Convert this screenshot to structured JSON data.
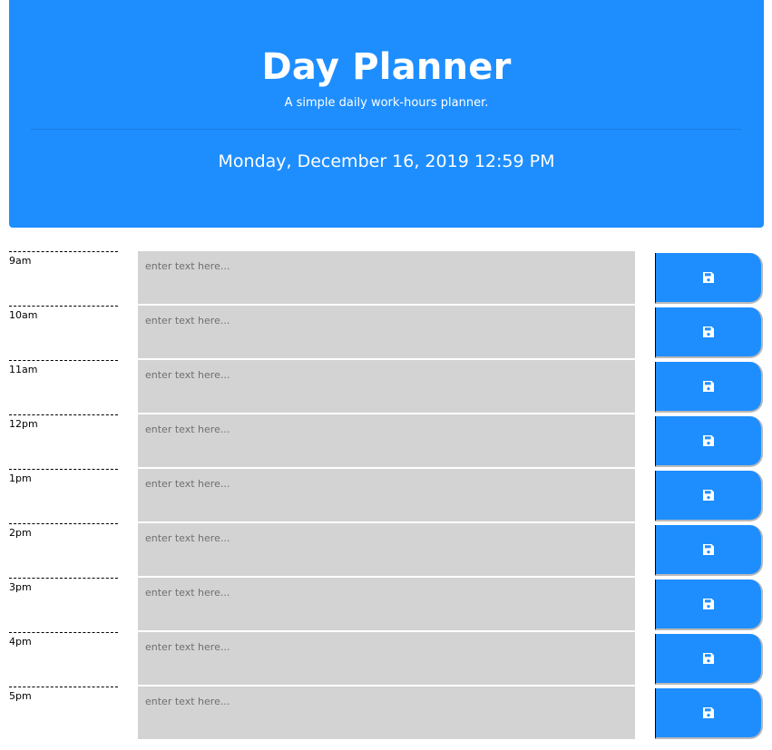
{
  "header": {
    "title": "Day Planner",
    "subtitle": "A simple daily work-hours planner.",
    "current_date": "Monday, December 16, 2019 12:59 PM"
  },
  "colors": {
    "primary": "#1e8eff",
    "textarea_bg": "#d3d3d3"
  },
  "planner": {
    "placeholder": "enter text here...",
    "save_icon": "floppy-disk-icon",
    "hours": [
      {
        "label": "9am",
        "text": ""
      },
      {
        "label": "10am",
        "text": ""
      },
      {
        "label": "11am",
        "text": ""
      },
      {
        "label": "12pm",
        "text": ""
      },
      {
        "label": "1pm",
        "text": ""
      },
      {
        "label": "2pm",
        "text": ""
      },
      {
        "label": "3pm",
        "text": ""
      },
      {
        "label": "4pm",
        "text": ""
      },
      {
        "label": "5pm",
        "text": ""
      }
    ]
  }
}
